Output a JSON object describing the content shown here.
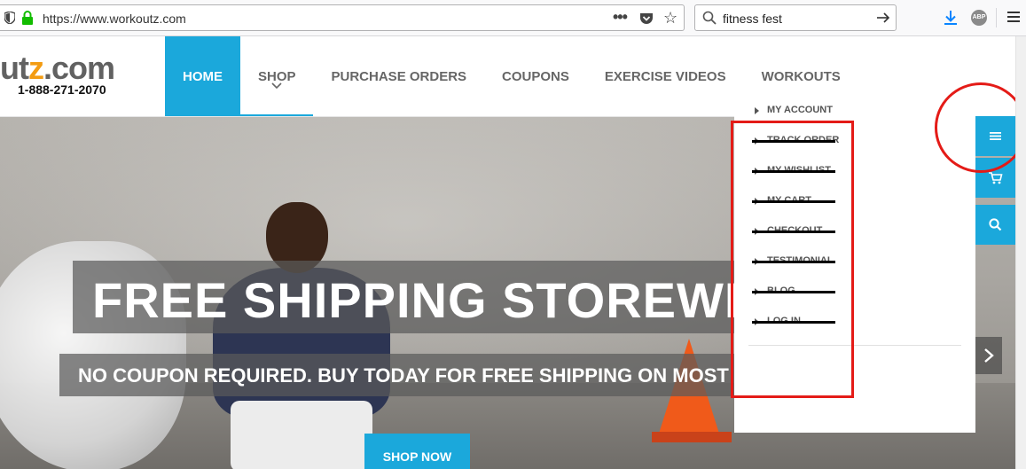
{
  "browser": {
    "url": "https://www.workoutz.com",
    "search_query": "fitness fest",
    "abp_label": "ABP"
  },
  "site": {
    "logo_text_main": "ut",
    "logo_text_accent": "z",
    "logo_text_suffix": ".com",
    "phone": "1-888-271-2070",
    "nav": [
      "HOME",
      "SHOP",
      "PURCHASE ORDERS",
      "COUPONS",
      "EXERCISE VIDEOS",
      "WORKOUTS"
    ],
    "hero": {
      "headline": "FREE SHIPPING STOREWIDE",
      "subline": "NO COUPON REQUIRED. BUY TODAY FOR FREE SHIPPING ON MOST ITEMS",
      "cta": "SHOP NOW"
    },
    "side_menu": [
      {
        "label": "MY ACCOUNT",
        "struck": false
      },
      {
        "label": "TRACK ORDER",
        "struck": true
      },
      {
        "label": "MY WISHLIST",
        "struck": true
      },
      {
        "label": "MY CART",
        "struck": true
      },
      {
        "label": "CHECKOUT",
        "struck": true
      },
      {
        "label": "TESTIMONIAL",
        "struck": true
      },
      {
        "label": "BLOG",
        "struck": true
      },
      {
        "label": "LOG IN",
        "struck": true
      }
    ]
  },
  "colors": {
    "accent": "#1ba8db",
    "annotation": "#e41b17",
    "logo_accent": "#f39c12"
  }
}
